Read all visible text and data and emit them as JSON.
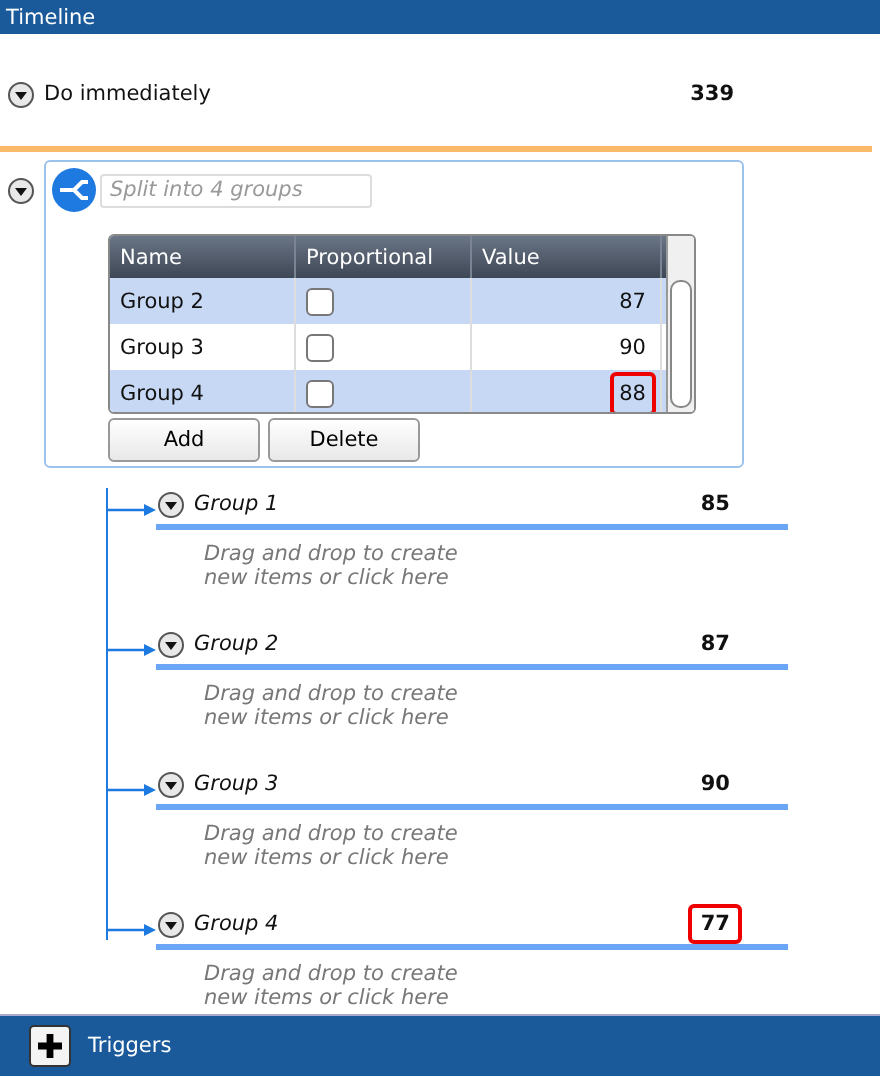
{
  "window": {
    "title": "Timeline"
  },
  "immediate": {
    "label": "Do immediately",
    "value": "339",
    "expanded": true
  },
  "split": {
    "expanded": true,
    "placeholder": "Split into 4 groups",
    "table": {
      "columns": [
        "Name",
        "Proportional",
        "Value"
      ],
      "rows": [
        {
          "name": "Group 2",
          "proportional": false,
          "value": "87",
          "alternate": true,
          "highlighted": false
        },
        {
          "name": "Group 3",
          "proportional": false,
          "value": "90",
          "alternate": false,
          "highlighted": false
        },
        {
          "name": "Group 4",
          "proportional": false,
          "value": "88",
          "alternate": true,
          "highlighted": true
        }
      ]
    },
    "buttons": [
      "Add",
      "Delete"
    ]
  },
  "groups": [
    {
      "name": "Group 1",
      "value": "85",
      "expanded": true,
      "highlighted": false,
      "hint": "Drag and drop to create new items or click here"
    },
    {
      "name": "Group 2",
      "value": "87",
      "expanded": true,
      "highlighted": false,
      "hint": "Drag and drop to create new items or click here"
    },
    {
      "name": "Group 3",
      "value": "90",
      "expanded": true,
      "highlighted": false,
      "hint": "Drag and drop to create new items or click here"
    },
    {
      "name": "Group 4",
      "value": "77",
      "expanded": true,
      "highlighted": true,
      "hint": "Drag and drop to create new items or click here"
    }
  ],
  "footer": {
    "label": "Triggers"
  }
}
